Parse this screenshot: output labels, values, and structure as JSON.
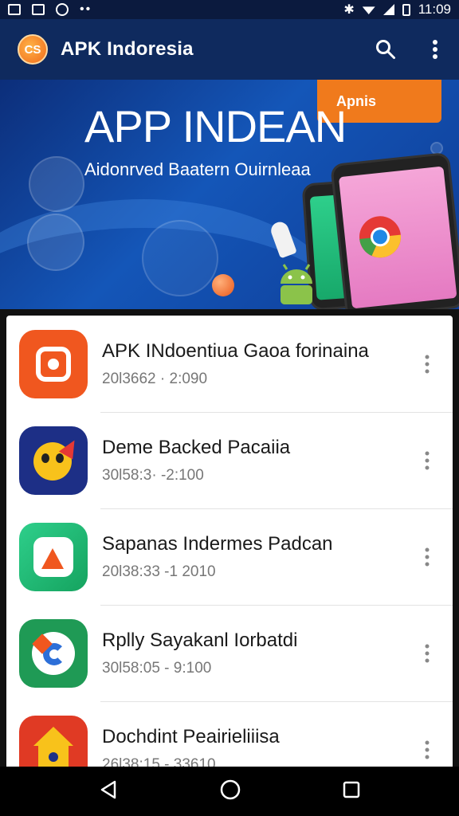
{
  "status_bar": {
    "time": "11:09",
    "icons": [
      "image-icon",
      "image-icon",
      "sync-icon",
      "more-notifications-icon",
      "bluetooth-icon",
      "wifi-icon",
      "signal-icon",
      "battery-icon"
    ]
  },
  "app_bar": {
    "logo_text": "CS",
    "title": "APK Indoresia",
    "actions": [
      "search-icon",
      "overflow-menu-icon"
    ]
  },
  "banner": {
    "title": "APP INDEAN",
    "subtitle": "Aidonrved Baatern Ouirnleaa",
    "badge": "Apnis",
    "colors": {
      "bg": "#1456b8",
      "badge": "#f07a1c"
    }
  },
  "apps": [
    {
      "title": "APK INdoentiua Gaoa forinaina",
      "meta": "20l3662 · 2:090",
      "icon": "orange-camera-app-icon",
      "color": "#f0571f"
    },
    {
      "title": "Deme Backed Pacaiia",
      "meta": "30l58:3· -2:100",
      "icon": "sun-character-app-icon",
      "color": "#1d2f86"
    },
    {
      "title": "Sapanas Indermes Padcan",
      "meta": "20l38:33 -1 2010",
      "icon": "green-letter-app-icon",
      "color": "#1fae6b"
    },
    {
      "title": "Rplly Sayakanl Iorbatdi",
      "meta": "30l58:05 - 9:100",
      "icon": "green-g-app-icon",
      "color": "#1f9a55"
    },
    {
      "title": "Dochdint Peairieliiisa",
      "meta": "26l38:15 - 33610",
      "icon": "red-house-app-icon",
      "color": "#e03a24"
    }
  ],
  "nav_bar": [
    "back-icon",
    "home-icon",
    "recents-icon"
  ]
}
